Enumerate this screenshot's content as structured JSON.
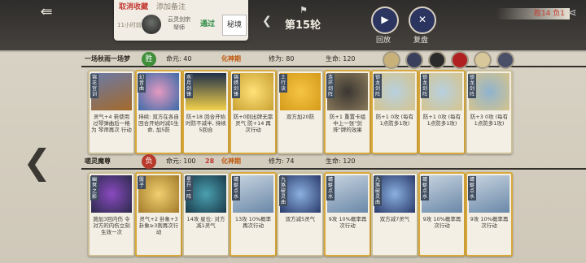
{
  "header": {
    "cancel_fav": "取消收藏",
    "add_note": "添加备注",
    "time_ago": "11小时前",
    "opponent_name": "云灵剑宗 琴师",
    "result": "通过",
    "realm_btn": "秘境",
    "round_label": "第15轮",
    "replay": "回放",
    "review": "复盘",
    "score": "胜14 负1"
  },
  "top_player": {
    "name": "一场秋雨一场梦",
    "badge": "胜",
    "hp": "命元: 40",
    "realm": "化神期",
    "cultivation": "修为: 80",
    "life": "生命: 120",
    "cards": [
      {
        "title": "锦花宫训",
        "cost": "",
        "desc": "灵气+4 若使用过琴弹曲后一格为 琴师再次 行动"
      },
      {
        "title": "幻音曲",
        "cost": "",
        "desc": "持续: 双方在各自回合开始时减5生命, 加5防"
      },
      {
        "title": "水月剑锋",
        "cost": "",
        "desc": "防+18 回合开始时防不减半, 持续5回合"
      },
      {
        "title": "锦绣剑锋",
        "cost": "",
        "desc": "防+0则出牌无需灵气 防+14 再次行动"
      },
      {
        "title": "土行诀",
        "cost": "",
        "desc": "双方加20防"
      },
      {
        "title": "连环剑阵",
        "cost": "",
        "desc": "防+1 重置卡组中上一张\"剑阵\"牌的效果"
      },
      {
        "title": "锁龙剑阵",
        "cost": "",
        "desc": "防+1 0攻 (每有1点防多1攻)"
      },
      {
        "title": "锁龙剑阵",
        "cost": "",
        "desc": "防+1 0攻 (每有1点防多1攻)"
      },
      {
        "title": "锁龙剑阵",
        "cost": "",
        "desc": "防+3 0攻 (每有1点防多1攻)"
      }
    ]
  },
  "bottom_player": {
    "name": "嗟灵魔尊",
    "badge": "负",
    "hp": "命元: 100",
    "hp_loss": "28",
    "realm": "化神期",
    "cultivation": "修为: 74",
    "life": "生命: 120",
    "cards": [
      {
        "title": "幽冥之影",
        "cost": "",
        "desc": "施加3回内伤 令对方的内伤立刻生效一次"
      },
      {
        "title": "骰子",
        "cost": "",
        "desc": "灵气+2 卦象+3 卦象≥3则再次行动"
      },
      {
        "title": "星升一阵",
        "cost": "",
        "desc": "14攻 星位: 对方减1灵气"
      },
      {
        "title": "蜻蜓点水",
        "cost": "",
        "desc": "13攻 10%概率再次行动"
      },
      {
        "title": "九煞破灵曲",
        "cost": "",
        "desc": "双方减5灵气"
      },
      {
        "title": "蜻蜓点水",
        "cost": "",
        "desc": "9攻 10%概率再次行动"
      },
      {
        "title": "九煞破灵曲",
        "cost": "",
        "desc": "双方减7灵气"
      },
      {
        "title": "蜻蜓点水",
        "cost": "",
        "desc": "9攻 10%概率再次行动"
      },
      {
        "title": "蜻蜓点水",
        "cost": "",
        "desc": "9攻 10%概率再次行动"
      }
    ]
  },
  "colors": {
    "win": "#3f8f3a",
    "lose": "#b83a2c",
    "gold": "#d8a83a",
    "realm": "#c05a10"
  },
  "icons": [
    "back-icon",
    "flag-icon",
    "chevron-left-icon",
    "replay-icon",
    "review-icon",
    "share-icon",
    "arrow-left-icon"
  ]
}
